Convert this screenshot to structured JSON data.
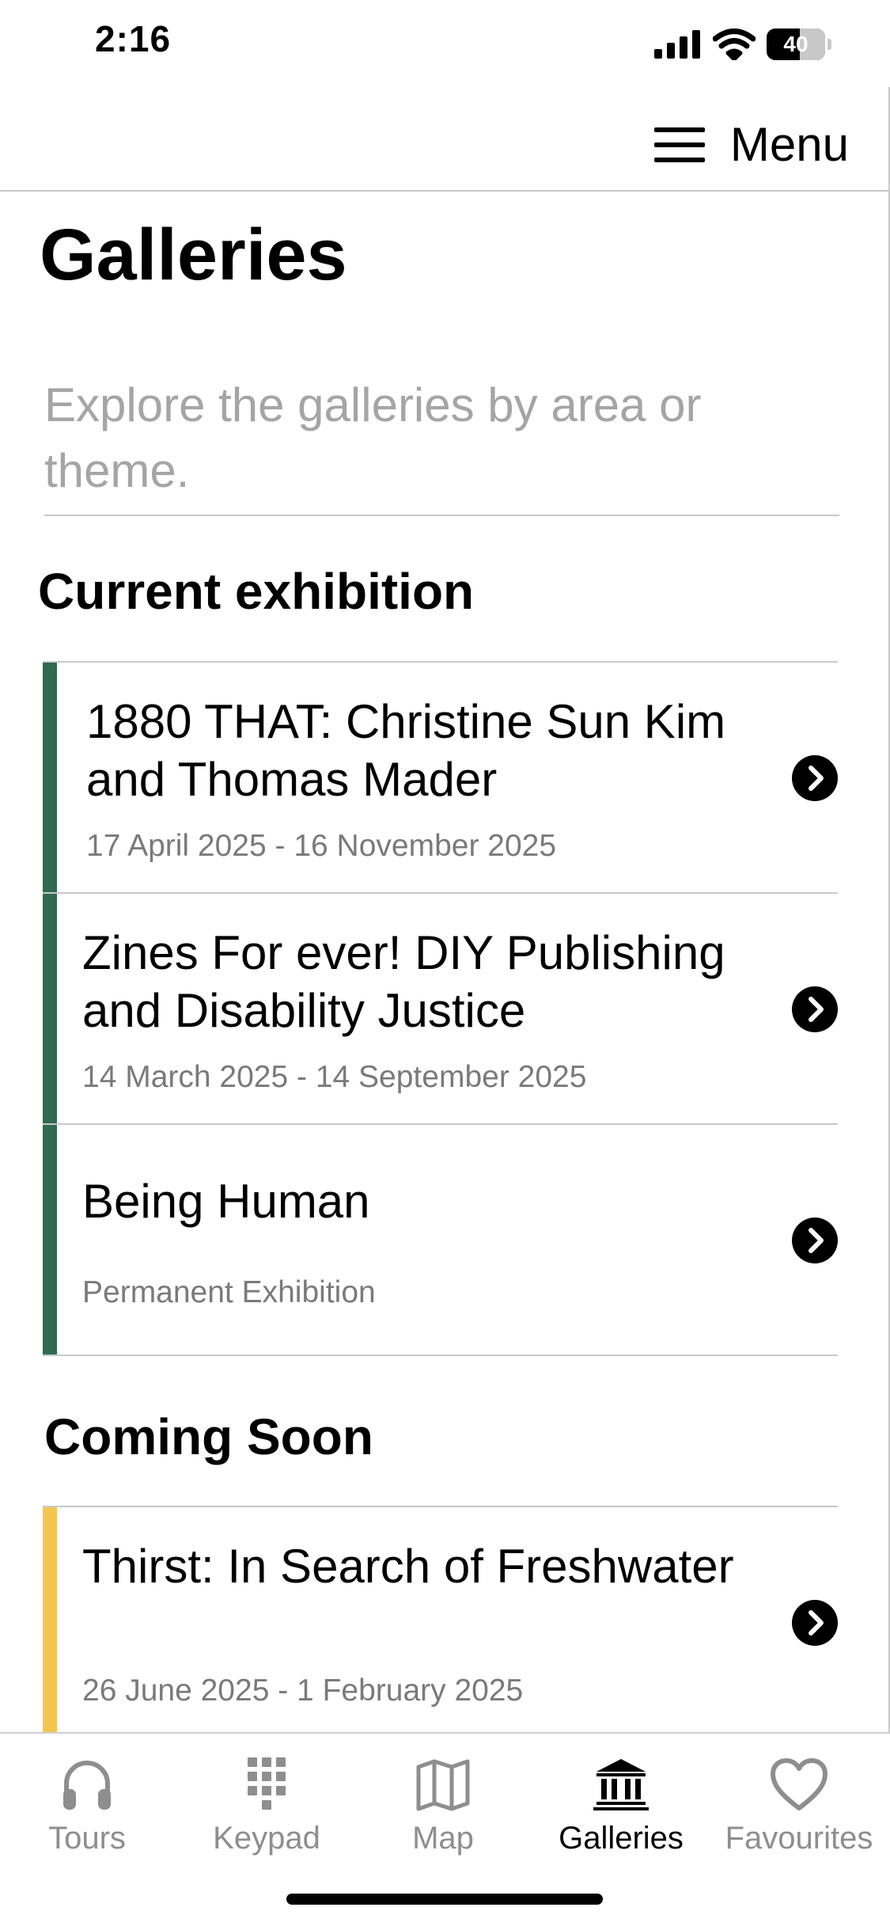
{
  "status_bar": {
    "time": "2:16",
    "battery": "40"
  },
  "header": {
    "menu_label": "Menu"
  },
  "page": {
    "title": "Galleries",
    "intro": "Explore the galleries by area or theme."
  },
  "sections": [
    {
      "title": "Current exhibition",
      "accent_color": "#2e6b50",
      "items": [
        {
          "title": "1880 THAT: Christine Sun Kim and Thomas Mader",
          "date": "17 April 2025 - 16 November 2025"
        },
        {
          "title": "Zines For ever! DIY Publishing and Disability Justice",
          "date": "14 March 2025 - 14 September 2025"
        },
        {
          "title": "Being Human",
          "date": "Permanent Exhibition"
        }
      ]
    },
    {
      "title": "Coming Soon",
      "accent_color": "#f2c64e",
      "items": [
        {
          "title": "Thirst: In Search of Freshwater",
          "date": "26 June 2025 - 1 February 2025"
        }
      ]
    }
  ],
  "tab_bar": {
    "tabs": [
      {
        "label": "Tours",
        "icon": "headphones-icon"
      },
      {
        "label": "Keypad",
        "icon": "keypad-icon"
      },
      {
        "label": "Map",
        "icon": "map-icon"
      },
      {
        "label": "Galleries",
        "icon": "museum-icon",
        "active": true
      },
      {
        "label": "Favourites",
        "icon": "heart-icon"
      }
    ]
  }
}
